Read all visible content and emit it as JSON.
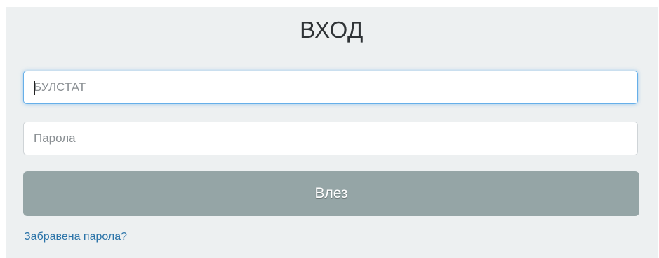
{
  "login": {
    "title": "ВХОД",
    "username": {
      "value": "",
      "placeholder": "БУЛСТАТ"
    },
    "password": {
      "value": "",
      "placeholder": "Парола"
    },
    "submit_label": "Влез",
    "forgot_label": "Забравена парола?"
  },
  "colors": {
    "panel_bg": "#edf0f1",
    "button_bg": "#95a5a6",
    "focus_border": "#66afe9",
    "link": "#2a73a8"
  }
}
